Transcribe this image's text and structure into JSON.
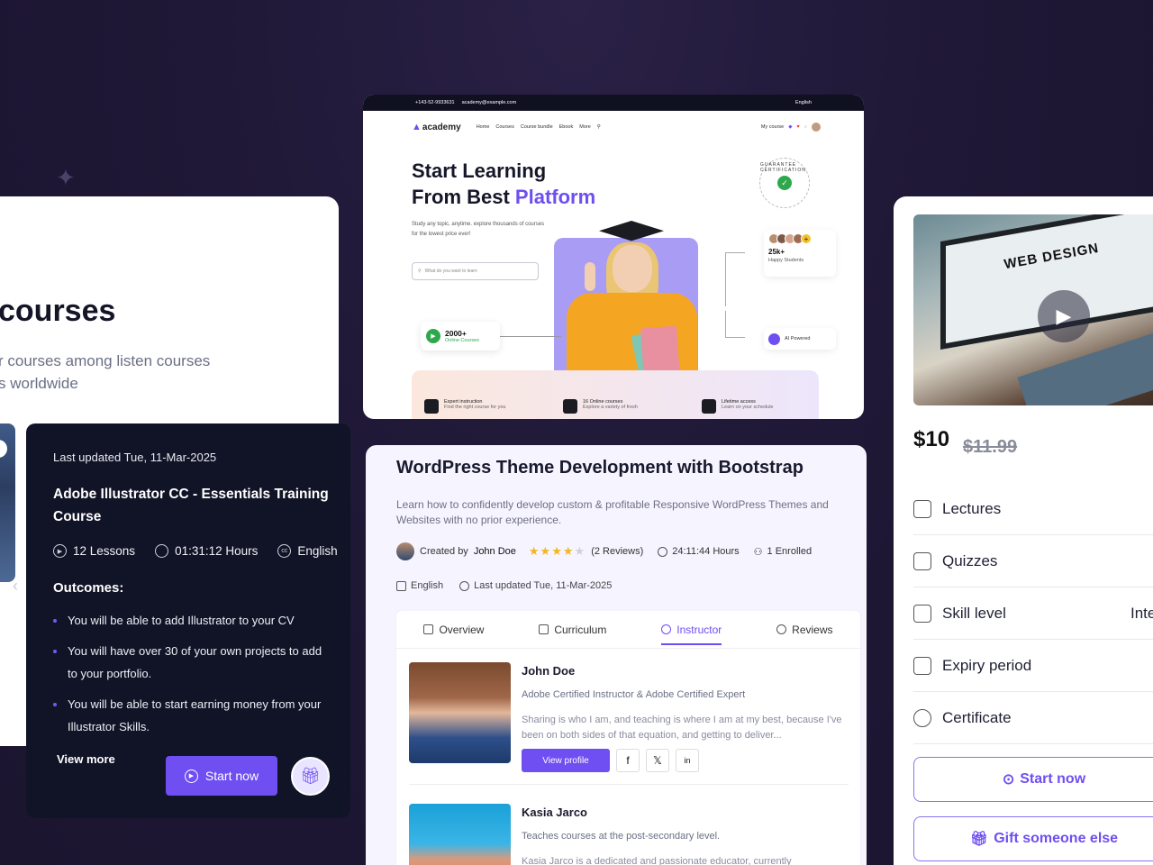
{
  "left_card": {
    "title": "courses",
    "description": "r courses among listen courses\ns worldwide"
  },
  "course_panel": {
    "last_updated": "Last updated Tue, 11-Mar-2025",
    "title": "Adobe Illustrator CC - Essentials Training Course",
    "lessons": "12 Lessons",
    "hours": "01:31:12 Hours",
    "language": "English",
    "outcomes_heading": "Outcomes:",
    "outcomes": [
      "You will be able to add Illustrator to your CV",
      "You will have over 30 of your own projects to add to your portfolio.",
      "You will be able to start earning money from your Illustrator Skills."
    ],
    "view_more": "View more",
    "start_label": "Start now"
  },
  "site": {
    "phone": "+143-52-9933631",
    "email": "academy@example.com",
    "lang": "English",
    "logo": "academy",
    "nav": [
      "Home",
      "Courses",
      "Course bundle",
      "Ebook",
      "More"
    ],
    "my_course": "My course",
    "headline_1": "Start Learning",
    "headline_2a": "From Best ",
    "headline_2b": "Platform",
    "subtext": "Study any topic, anytime. explore thousands of courses for the lowest price ever!",
    "search_placeholder": "What do you want to learn",
    "online_courses_count": "2000+",
    "online_courses_label": "Online Courses",
    "students_count": "25k+",
    "students_label": "Happy Students",
    "ai_label": "AI Powered",
    "guarantee": "GUARANTEE CERTIFICATION",
    "features": [
      {
        "title": "Expert instruction",
        "sub": "Find the right course for you"
      },
      {
        "title": "16 Online courses",
        "sub": "Explore a variety of fresh"
      },
      {
        "title": "Lifetime access",
        "sub": "Learn on your schedule"
      }
    ]
  },
  "course": {
    "title": "WordPress Theme Development with Bootstrap",
    "description": "Learn how to confidently develop custom & profitable Responsive WordPress Themes and Websites with no prior experience.",
    "created_by": "Created by",
    "creator": "John Doe",
    "rating": 4,
    "reviews": "(2 Reviews)",
    "duration": "24:11:44 Hours",
    "enrolled": "1 Enrolled",
    "language": "English",
    "last_updated": "Last updated Tue, 11-Mar-2025",
    "tabs": [
      "Overview",
      "Curriculum",
      "Instructor",
      "Reviews"
    ],
    "active_tab": "Instructor",
    "instructors": [
      {
        "name": "John Doe",
        "role": "Adobe Certified Instructor & Adobe Certified Expert",
        "bio": "Sharing is who I am, and teaching is where I am at my best, because I've been on both sides of that equation, and getting to deliver...",
        "view_profile": "View profile"
      },
      {
        "name": "Kasia Jarco",
        "role": "Teaches courses at the post-secondary level.",
        "bio": "Kasia Jarco is a dedicated and passionate educator, currently"
      }
    ]
  },
  "pricing": {
    "thumbnail_text": "WEB DESIGN",
    "price": "$10",
    "old_price": "$11.99",
    "features": [
      {
        "label": "Lectures",
        "icon": "lectures-icon"
      },
      {
        "label": "Quizzes",
        "icon": "quizzes-icon"
      },
      {
        "label": "Skill level",
        "value": "Inte",
        "icon": "skill-icon"
      },
      {
        "label": "Expiry period",
        "icon": "expiry-icon"
      },
      {
        "label": "Certificate",
        "icon": "certificate-icon"
      }
    ],
    "start_label": "Start now",
    "gift_label": "Gift someone else"
  },
  "colors": {
    "background": "#1f1836",
    "accent": "#6f4ef2",
    "dark_card": "#111427",
    "star": "#f5b51e"
  }
}
